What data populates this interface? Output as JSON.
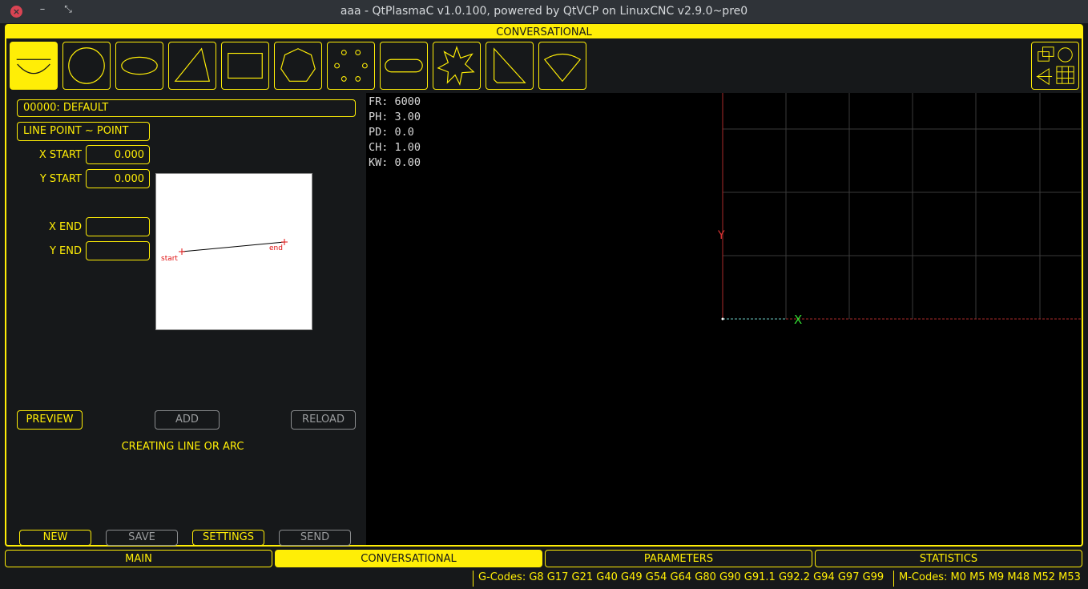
{
  "window": {
    "title": "aaa - QtPlasmaC v1.0.100, powered by QtVCP on LinuxCNC v2.9.0~pre0",
    "close_glyph": "×",
    "min_glyph": "–",
    "max_glyph": "⤡"
  },
  "header": {
    "label": "CONVERSATIONAL"
  },
  "shapes": [
    {
      "name": "line-icon",
      "active": true
    },
    {
      "name": "circle-icon"
    },
    {
      "name": "ellipse-icon"
    },
    {
      "name": "triangle-icon"
    },
    {
      "name": "rectangle-icon"
    },
    {
      "name": "polygon-icon"
    },
    {
      "name": "bolt-circle-icon"
    },
    {
      "name": "slot-icon"
    },
    {
      "name": "star-icon"
    },
    {
      "name": "gusset-icon"
    },
    {
      "name": "sector-icon"
    }
  ],
  "left": {
    "material": "00000: DEFAULT",
    "line_type": "LINE POINT ~ POINT",
    "x_start_label": "X START",
    "x_start_value": "0.000",
    "y_start_label": "Y START",
    "y_start_value": "0.000",
    "x_end_label": "X END",
    "x_end_value": "",
    "y_end_label": "Y END",
    "y_end_value": "",
    "diagram": {
      "start_label": "start",
      "end_label": "end"
    },
    "preview_btn": "PREVIEW",
    "add_btn": "ADD",
    "reload_btn": "RELOAD",
    "status": "CREATING LINE OR ARC",
    "new_btn": "NEW",
    "save_btn": "SAVE",
    "settings_btn": "SETTINGS",
    "send_btn": "SEND"
  },
  "readout": [
    {
      "key": "FR:",
      "value": "6000"
    },
    {
      "key": "PH:",
      "value": "3.00"
    },
    {
      "key": "PD:",
      "value": "0.0"
    },
    {
      "key": "CH:",
      "value": "1.00"
    },
    {
      "key": "KW:",
      "value": "0.00"
    }
  ],
  "axes": {
    "x_label": "X",
    "y_label": "Y",
    "x_color": "#33dd33",
    "y_color": "#dd3333"
  },
  "tabs": [
    {
      "label": "MAIN"
    },
    {
      "label": "CONVERSATIONAL",
      "active": true
    },
    {
      "label": "PARAMETERS"
    },
    {
      "label": "STATISTICS"
    }
  ],
  "statusbar": {
    "gcodes": "G-Codes: G8 G17 G21 G40 G49 G54 G64 G80 G90 G91.1 G92.2 G94 G97 G99",
    "mcodes": "M-Codes: M0 M5 M9 M48 M52 M53"
  },
  "colors": {
    "accent": "#ffee06",
    "background": "#16181a",
    "canvas": "#000000"
  }
}
